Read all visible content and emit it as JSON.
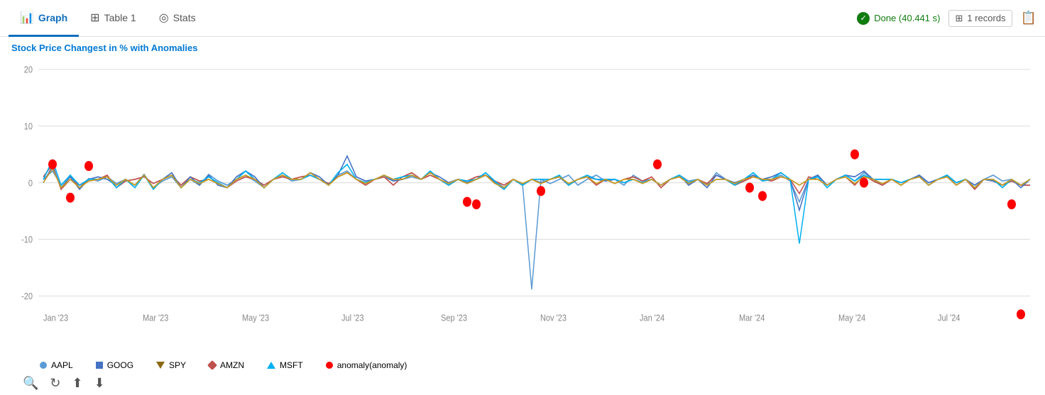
{
  "tabs": [
    {
      "id": "graph",
      "label": "Graph",
      "icon": "📊",
      "active": true
    },
    {
      "id": "table1",
      "label": "Table 1",
      "icon": "⊞",
      "active": false
    },
    {
      "id": "stats",
      "label": "Stats",
      "icon": "◎",
      "active": false
    }
  ],
  "status": {
    "done_label": "Done (40.441 s)",
    "records_label": "1 records"
  },
  "chart": {
    "title": "Stock Price Changest in % with Anomalies",
    "y_axis": {
      "max": 20,
      "mid": 10,
      "zero": 0,
      "neg_mid": -10,
      "min": -20
    },
    "x_labels": [
      "Jan '23",
      "Mar '23",
      "May '23",
      "Jul '23",
      "Sep '23",
      "Nov '23",
      "Jan '24",
      "Mar '24",
      "May '24",
      "Jul '24"
    ]
  },
  "legend": [
    {
      "id": "aapl",
      "label": "AAPL",
      "color": "#5B9BD5",
      "shape": "circle"
    },
    {
      "id": "amzn",
      "label": "AMZN",
      "color": "#C0504D",
      "shape": "diamond"
    },
    {
      "id": "goog",
      "label": "GOOG",
      "color": "#4472C4",
      "shape": "square"
    },
    {
      "id": "msft",
      "label": "MSFT",
      "color": "#00B0F0",
      "shape": "triangle-up"
    },
    {
      "id": "spy",
      "label": "SPY",
      "color": "#8B6914",
      "shape": "triangle-down"
    },
    {
      "id": "anomaly",
      "label": "anomaly(anomaly)",
      "color": "#FF0000",
      "shape": "circle"
    }
  ],
  "toolbar": {
    "search_label": "🔍",
    "refresh_label": "↻",
    "export_label": "⬆",
    "download_label": "⬇"
  }
}
